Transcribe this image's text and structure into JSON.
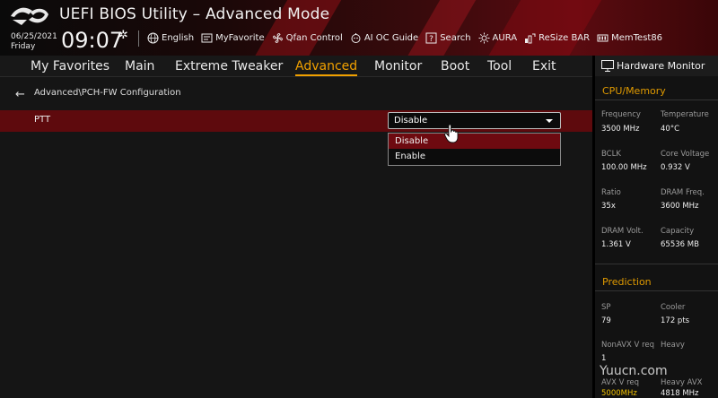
{
  "header": {
    "title": "UEFI BIOS Utility – Advanced Mode",
    "date": "06/25/2021",
    "day": "Friday",
    "time": "09:07",
    "tools": [
      {
        "label": "English",
        "icon": "globe-icon"
      },
      {
        "label": "MyFavorite",
        "icon": "favorite-icon"
      },
      {
        "label": "Qfan Control",
        "icon": "fan-icon"
      },
      {
        "label": "AI OC Guide",
        "icon": "ai-icon"
      },
      {
        "label": "Search",
        "icon": "search-icon"
      },
      {
        "label": "AURA",
        "icon": "aura-icon"
      },
      {
        "label": "ReSize BAR",
        "icon": "resize-bar-icon"
      },
      {
        "label": "MemTest86",
        "icon": "memtest-icon"
      }
    ]
  },
  "menu": {
    "items": [
      "My Favorites",
      "Main",
      "Extreme Tweaker",
      "Advanced",
      "Monitor",
      "Boot",
      "Tool",
      "Exit"
    ],
    "active": "Advanced"
  },
  "main": {
    "breadcrumb": "Advanced\\PCH-FW Configuration",
    "setting": {
      "label": "PTT",
      "value": "Disable"
    },
    "dropdown": {
      "options": [
        "Disable",
        "Enable"
      ],
      "highlighted": "Disable"
    }
  },
  "hw_monitor": {
    "title": "Hardware Monitor",
    "cpu_memory": {
      "title": "CPU/Memory",
      "rows": [
        [
          {
            "label": "Frequency",
            "value": "3500 MHz"
          },
          {
            "label": "Temperature",
            "value": "40°C"
          }
        ],
        [
          {
            "label": "BCLK",
            "value": "100.00 MHz"
          },
          {
            "label": "Core Voltage",
            "value": "0.932 V"
          }
        ],
        [
          {
            "label": "Ratio",
            "value": "35x"
          },
          {
            "label": "DRAM Freq.",
            "value": "3600 MHz"
          }
        ],
        [
          {
            "label": "DRAM Volt.",
            "value": "1.361 V"
          },
          {
            "label": "Capacity",
            "value": "65536 MB"
          }
        ]
      ]
    },
    "prediction": {
      "title": "Prediction",
      "rows": [
        [
          {
            "label": "SP",
            "value": "79"
          },
          {
            "label": "Cooler",
            "value": "172 pts"
          }
        ],
        [
          {
            "label": "NonAVX V req",
            "value": "1"
          },
          {
            "label": "Heavy",
            "value": ""
          }
        ],
        [
          {
            "label": "AVX V req",
            "value": "5000MHz"
          },
          {
            "label": "Heavy AVX",
            "value": "4818 MHz"
          }
        ]
      ]
    }
  },
  "watermark": "Yuucn.com",
  "colors": {
    "accent": "#f0a000",
    "highlight_row": "#5e0a0d",
    "dropdown_highlight": "#6e0a10"
  }
}
